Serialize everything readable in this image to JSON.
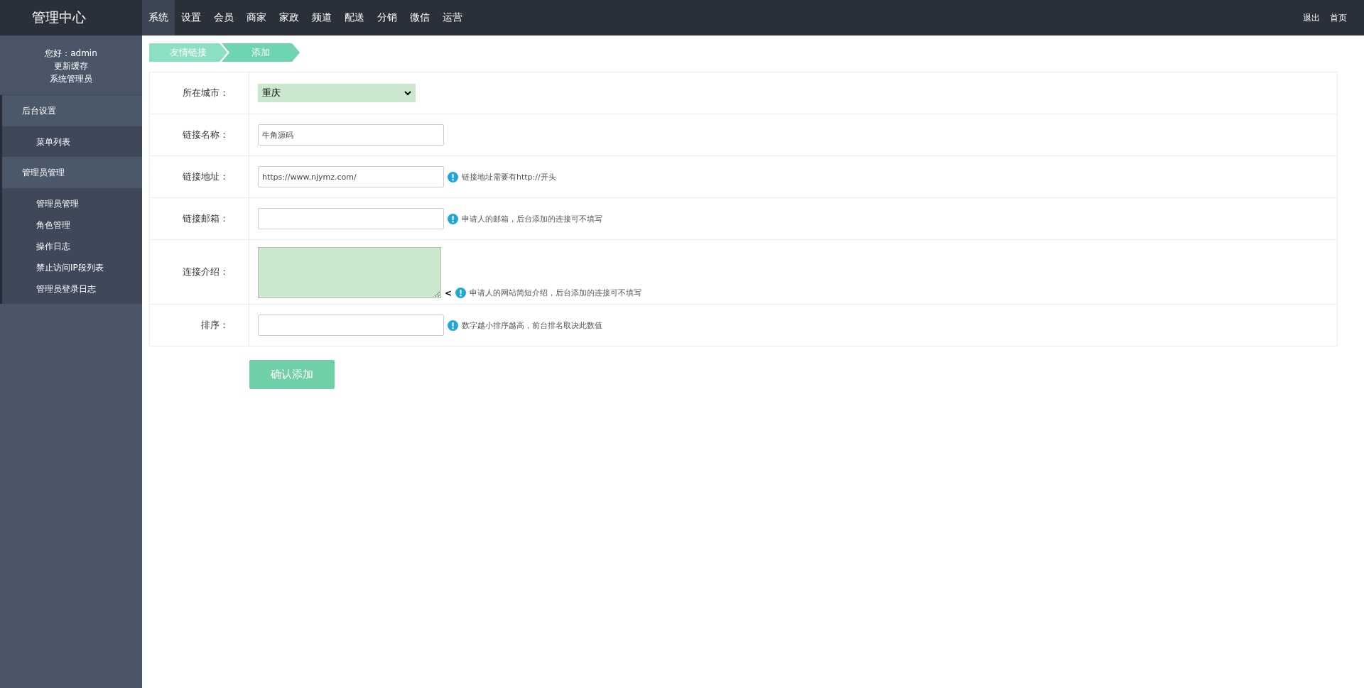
{
  "brand": "管理中心",
  "nav": [
    {
      "label": "系统",
      "selected": true
    },
    {
      "label": "设置",
      "selected": false
    },
    {
      "label": "会员",
      "selected": false
    },
    {
      "label": "商家",
      "selected": false
    },
    {
      "label": "家政",
      "selected": false
    },
    {
      "label": "频道",
      "selected": false
    },
    {
      "label": "配送",
      "selected": false
    },
    {
      "label": "分销",
      "selected": false
    },
    {
      "label": "微信",
      "selected": false
    },
    {
      "label": "运营",
      "selected": false
    }
  ],
  "top_links": [
    "退出",
    "首页"
  ],
  "sidebar": {
    "user": [
      "您好：admin",
      "更新缓存",
      "系统管理员"
    ],
    "groups": [
      {
        "label": "后台设置",
        "children": [
          {
            "label": "菜单列表"
          }
        ]
      },
      {
        "label": "管理员管理",
        "children": [
          {
            "label": "管理员管理"
          },
          {
            "label": "角色管理"
          },
          {
            "label": "操作日志"
          },
          {
            "label": "禁止访问IP段列表"
          },
          {
            "label": "管理员登录日志"
          }
        ]
      }
    ]
  },
  "breadcrumb": [
    "友情链接",
    "添加"
  ],
  "form": [
    {
      "kind": "select",
      "label": "所在城市：",
      "value": "重庆"
    },
    {
      "kind": "text",
      "label": "链接名称：",
      "value": "牛角源码"
    },
    {
      "kind": "text",
      "label": "链接地址：",
      "value": "https://www.njymz.com/",
      "hint": "链接地址需要有http://开头"
    },
    {
      "kind": "text",
      "label": "链接邮箱：",
      "hint": "申请人的邮箱，后台添加的连接可不填写"
    },
    {
      "kind": "textarea",
      "label": "连接介绍：",
      "prefix": "<",
      "hint": "申请人的网站简短介绍，后台添加的连接可不填写"
    },
    {
      "kind": "text",
      "label": "排序：",
      "hint": "数字越小排序越高，前台排名取决此数值"
    }
  ],
  "submit": "确认添加"
}
